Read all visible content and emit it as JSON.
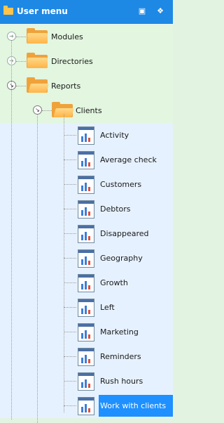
{
  "titlebar": {
    "title": "User menu",
    "restore_icon": "restore-icon",
    "pin_icon": "pin-icon"
  },
  "top_items": [
    {
      "label": "Modules",
      "expander": "collapsed"
    },
    {
      "label": "Directories",
      "expander": "collapsed"
    },
    {
      "label": "Reports",
      "expander": "expanded"
    }
  ],
  "clients": {
    "label": "Clients",
    "expander": "expanded"
  },
  "reports": [
    "Activity",
    "Average check",
    "Customers",
    "Debtors",
    "Disappeared",
    "Geography",
    "Growth",
    "Left",
    "Marketing",
    "Reminders",
    "Rush hours",
    "Work with clients"
  ],
  "selected_report": "Work with clients",
  "colors": {
    "titlebar": "#1e88e5",
    "selection": "#1e90ff",
    "row_green": "#e2f6e0",
    "row_blue": "#e6f1ff"
  }
}
